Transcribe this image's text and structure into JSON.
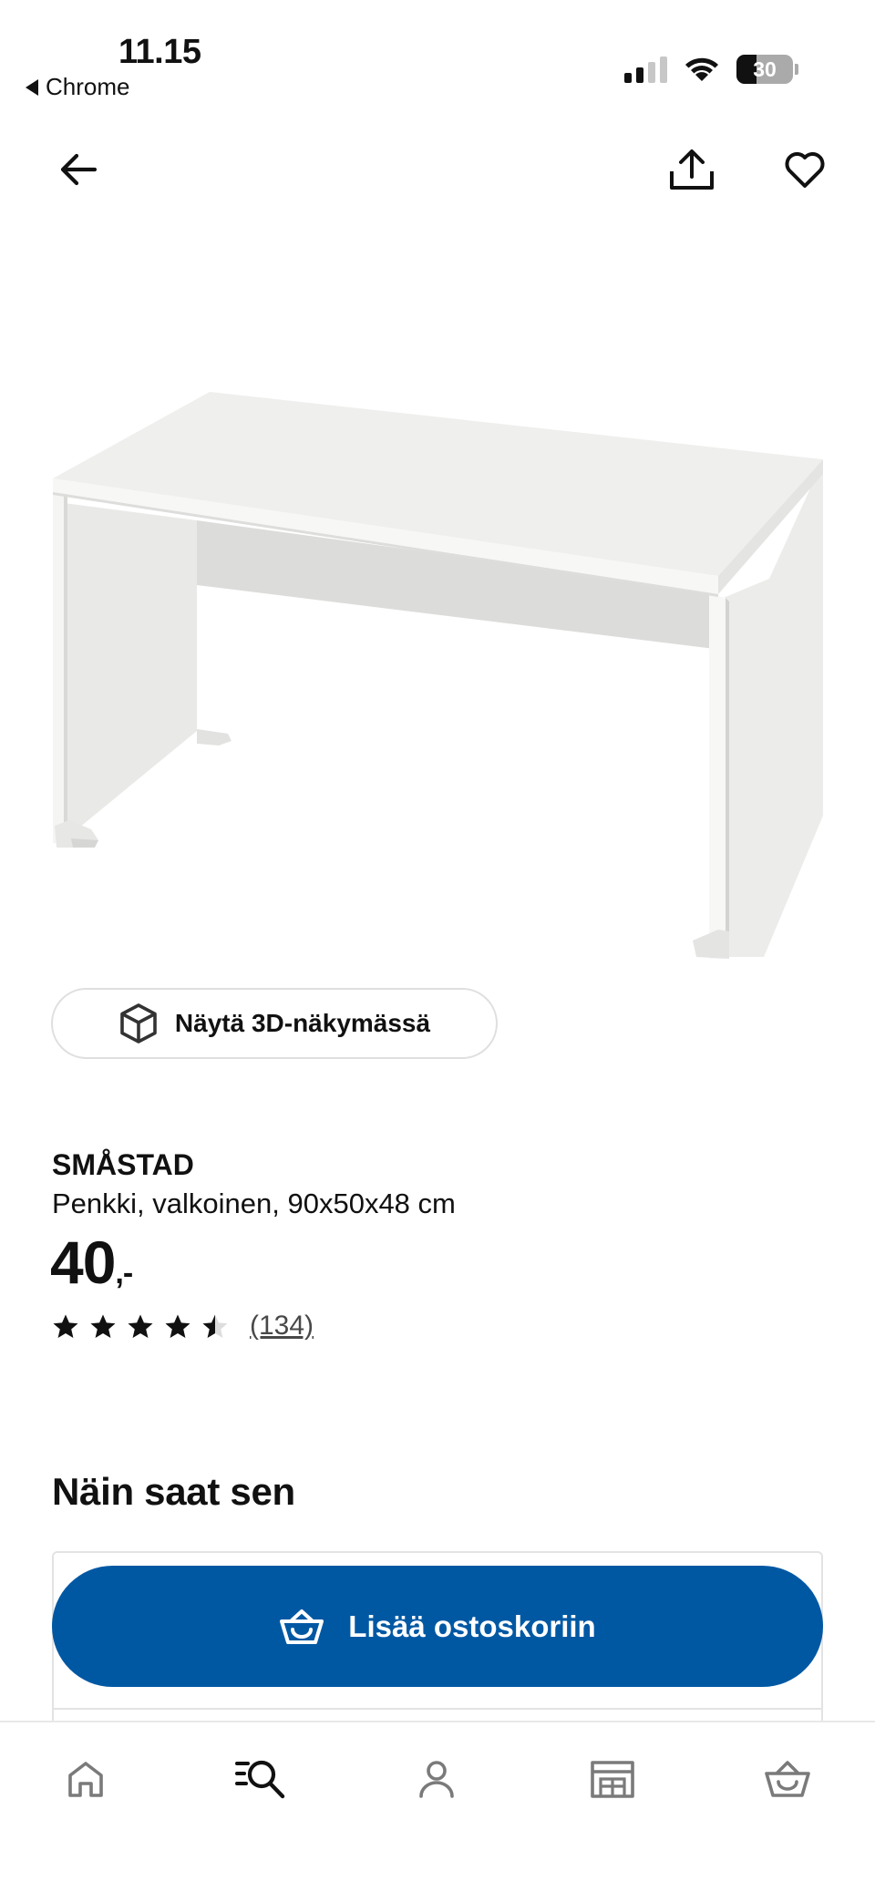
{
  "status_bar": {
    "time": "11.15",
    "back_app": "Chrome",
    "battery": "30"
  },
  "header": {
    "icons": [
      "back-arrow-icon",
      "share-icon",
      "heart-icon"
    ]
  },
  "product": {
    "view_3d_label": "Näytä 3D-näkymässä",
    "brand": "SMÅSTAD",
    "description": "Penkki, valkoinen, 90x50x48 cm",
    "price": "40",
    "price_suffix": ",-",
    "rating": 4.5,
    "rating_max": 5,
    "review_count": "(134)"
  },
  "delivery": {
    "section_title": "Näin saat sen",
    "add_to_cart_label": "Lisää ostoskoriin"
  },
  "bottom_nav": {
    "items": [
      "home-icon",
      "search-icon",
      "profile-icon",
      "store-icon",
      "cart-icon"
    ],
    "active": "search-icon"
  },
  "colors": {
    "primary_blue": "#0058a3",
    "text": "#111111",
    "inactive_icon": "#7a7a7a"
  }
}
